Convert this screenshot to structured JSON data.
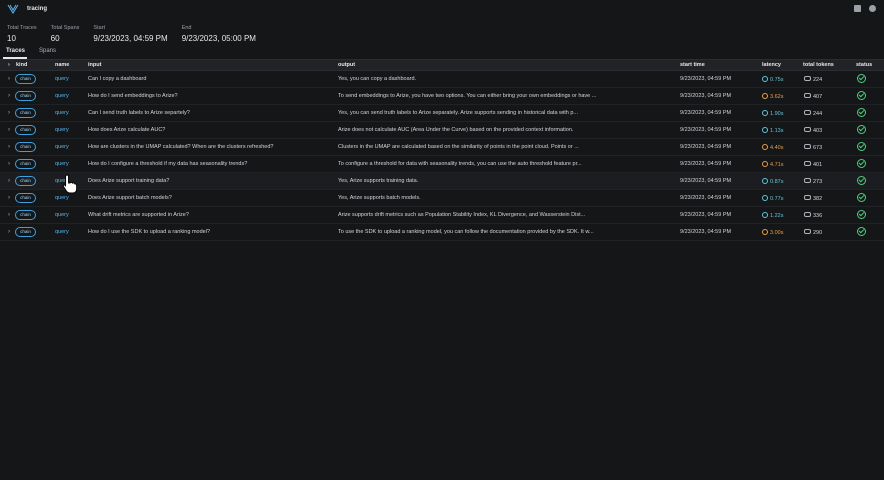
{
  "app": {
    "title": "tracing"
  },
  "icons": {
    "logo": "phoenix-logo-icon",
    "docs": "docs-icon",
    "github": "github-icon"
  },
  "stats": [
    {
      "label": "Total Traces",
      "value": "10"
    },
    {
      "label": "Total Spans",
      "value": "60"
    },
    {
      "label": "Start",
      "value": "9/23/2023, 04:59 PM"
    },
    {
      "label": "End",
      "value": "9/23/2023, 05:00 PM"
    }
  ],
  "tabs": [
    "Traces",
    "Spans"
  ],
  "columns": {
    "kind": "kind",
    "name": "name",
    "input": "input",
    "output": "output",
    "start_time": "start time",
    "latency": "latency",
    "total_tokens": "total tokens",
    "status": "status"
  },
  "colors": {
    "accent": "#58b7ee",
    "ok": "#4ccf7d",
    "warn": "#e8a04a",
    "fast": "#62c6e0"
  },
  "rows": [
    {
      "kind": "chain",
      "name": "query",
      "input": "Can I copy a dashboard",
      "output": "Yes, you can copy a dashboard.",
      "start": "9/23/2023, 04:59 PM",
      "latency": "0.75s",
      "lat_level": "fast",
      "tokens": "224"
    },
    {
      "kind": "chain",
      "name": "query",
      "input": "How do I send embeddings to Arize?",
      "output": "To send embeddings to Arize, you have two options. You can either bring your own embeddings or have ...",
      "start": "9/23/2023, 04:59 PM",
      "latency": "3.62s",
      "lat_level": "warn",
      "tokens": "407"
    },
    {
      "kind": "chain",
      "name": "query",
      "input": "Can I send truth labels to Arize separtely?",
      "output": "Yes, you can send truth labels to Arize separately. Arize supports sending in historical data with p...",
      "start": "9/23/2023, 04:59 PM",
      "latency": "1.90s",
      "lat_level": "fast",
      "tokens": "244"
    },
    {
      "kind": "chain",
      "name": "query",
      "input": "How does Arize calculate AUC?",
      "output": "Arize does not calculate AUC (Area Under the Curve) based on the provided context information.",
      "start": "9/23/2023, 04:59 PM",
      "latency": "1.13s",
      "lat_level": "fast",
      "tokens": "403"
    },
    {
      "kind": "chain",
      "name": "query",
      "input": "How are clusters in the UMAP calculated? When are the clusters refreshed?",
      "output": "Clusters in the UMAP are calculated based on the similarity of points in the point cloud. Points or ...",
      "start": "9/23/2023, 04:59 PM",
      "latency": "4.40s",
      "lat_level": "warn",
      "tokens": "673"
    },
    {
      "kind": "chain",
      "name": "query",
      "input": "How do I configure a threshold if my data has seasonality trends?",
      "output": "To configure a threshold for data with seasonality trends, you can use the auto threshold feature pr...",
      "start": "9/23/2023, 04:59 PM",
      "latency": "4.71s",
      "lat_level": "warn",
      "tokens": "401"
    },
    {
      "kind": "chain",
      "name": "query",
      "input": "Does Arize support training data?",
      "output": "Yes, Arize supports training data.",
      "start": "9/23/2023, 04:59 PM",
      "latency": "0.87s",
      "lat_level": "fast",
      "tokens": "273"
    },
    {
      "kind": "chain",
      "name": "query",
      "input": "Does Arize support batch models?",
      "output": "Yes, Arize supports batch models.",
      "start": "9/23/2023, 04:59 PM",
      "latency": "0.77s",
      "lat_level": "fast",
      "tokens": "382"
    },
    {
      "kind": "chain",
      "name": "query",
      "input": "What drift metrics are supported in Arize?",
      "output": "Arize supports drift metrics such as Population Stability Index, KL Divergence, and Wasserstein Dist...",
      "start": "9/23/2023, 04:59 PM",
      "latency": "1.22s",
      "lat_level": "fast",
      "tokens": "336"
    },
    {
      "kind": "chain",
      "name": "query",
      "input": "How do I use the SDK to upload a ranking model?",
      "output": "To use the SDK to upload a ranking model, you can follow the documentation provided by the SDK. It w...",
      "start": "9/23/2023, 04:59 PM",
      "latency": "3.00s",
      "lat_level": "warn",
      "tokens": "290"
    }
  ]
}
